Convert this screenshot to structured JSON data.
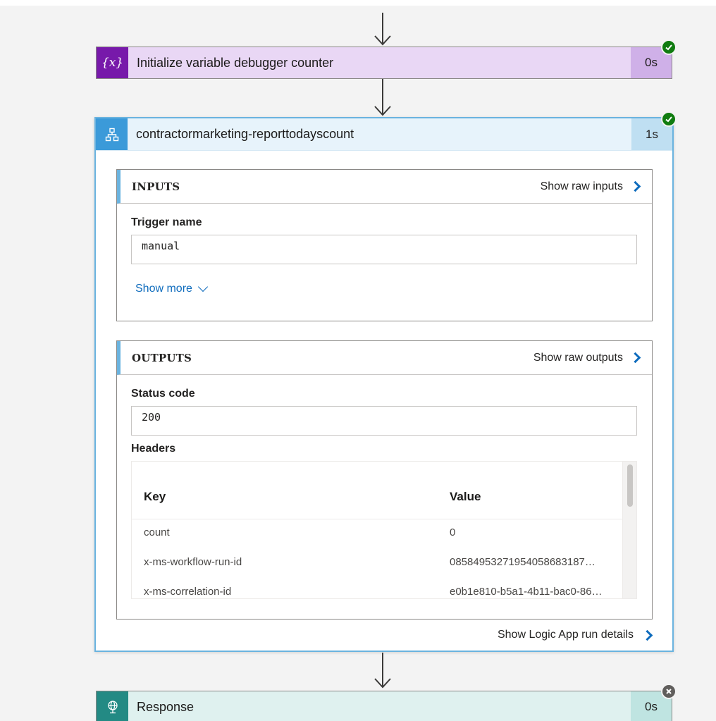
{
  "steps": {
    "variable": {
      "icon": "variable-braces-icon",
      "icon_text": "{x}",
      "title": "Initialize variable debugger counter",
      "duration": "0s",
      "status": "succeeded",
      "colors": {
        "icon_bg": "#7719aa",
        "header_bg": "#e9d7f5"
      }
    },
    "http": {
      "icon": "workflow-icon",
      "title": "contractormarketing-reporttodayscount",
      "duration": "1s",
      "status": "succeeded",
      "colors": {
        "icon_bg": "#3b9ad9",
        "header_bg": "#e7f3fb"
      },
      "inputs": {
        "title": "INPUTS",
        "show_raw": "Show raw inputs",
        "trigger_label": "Trigger name",
        "trigger_value": "manual",
        "show_more": "Show more"
      },
      "outputs": {
        "title": "OUTPUTS",
        "show_raw": "Show raw outputs",
        "status_label": "Status code",
        "status_value": "200",
        "headers_label": "Headers",
        "columns": {
          "key": "Key",
          "value": "Value"
        },
        "rows": [
          {
            "key": "count",
            "value": "0"
          },
          {
            "key": "x-ms-workflow-run-id",
            "value": "08584953271954058683187…"
          },
          {
            "key": "x-ms-correlation-id",
            "value": "e0b1e810-b5a1-4b11-bac0-86…"
          }
        ]
      },
      "run_details": "Show Logic App run details"
    },
    "response": {
      "icon": "globe-icon",
      "title": "Response",
      "duration": "0s",
      "status": "failed",
      "colors": {
        "icon_bg": "#238a84",
        "header_bg": "#dff1ef"
      }
    }
  },
  "colors": {
    "success": "#107c10",
    "failed": "#605e5c",
    "link": "#0f6cbd"
  }
}
